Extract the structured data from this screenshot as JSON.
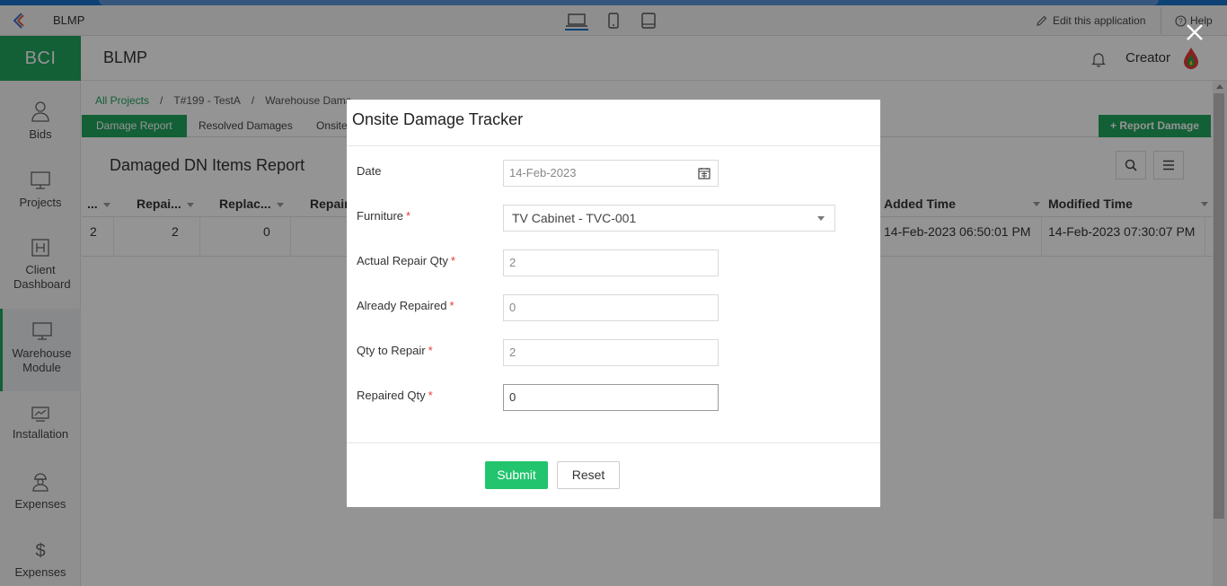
{
  "toolbar": {
    "app_name": "BLMP",
    "edit_app_label": "Edit this application",
    "help_label": "Help"
  },
  "header": {
    "brand": "BCI",
    "title": "BLMP",
    "user": "Creator"
  },
  "sidebar": {
    "items": [
      {
        "label": "Bids",
        "icon": "user-icon"
      },
      {
        "label": "Projects",
        "icon": "monitor-icon"
      },
      {
        "label": "Client Dashboard",
        "icon": "h-box-icon"
      },
      {
        "label": "Warehouse Module",
        "icon": "monitor-icon",
        "active": true
      },
      {
        "label": "Installation",
        "icon": "chart-icon"
      },
      {
        "label": "Expenses",
        "icon": "worker-icon"
      },
      {
        "label": "Expenses",
        "icon": "dollar-icon"
      }
    ]
  },
  "breadcrumb": {
    "root": "All Projects",
    "project": "T#199 - TestA",
    "current": "Warehouse Dama"
  },
  "tabs": {
    "damage_report": "Damage Report",
    "resolved_damages": "Resolved Damages",
    "onsite": "Onsite",
    "report_damage_button": "+ Report Damage"
  },
  "report": {
    "title": "Damaged DN Items Report",
    "columns": [
      "...",
      "Repai...",
      "Replac...",
      "Repair",
      "Added Time",
      "Modified Time"
    ],
    "rows": [
      {
        "c0": "2",
        "c1": "2",
        "c2": "0",
        "added": "14-Feb-2023 06:50:01 PM",
        "modified": "14-Feb-2023 07:30:07 PM"
      }
    ]
  },
  "modal": {
    "title": "Onsite Damage Tracker",
    "fields": {
      "date": {
        "label": "Date",
        "value": "14-Feb-2023"
      },
      "furniture": {
        "label": "Furniture",
        "value": "TV Cabinet - TVC-001"
      },
      "actual_repair_qty": {
        "label": "Actual Repair Qty",
        "value": "2"
      },
      "already_repaired": {
        "label": "Already Repaired",
        "value": "0"
      },
      "qty_to_repair": {
        "label": "Qty to Repair",
        "value": "2"
      },
      "repaired_qty": {
        "label": "Repaired Qty",
        "value": "0"
      }
    },
    "required_mark": "*",
    "submit_label": "Submit",
    "reset_label": "Reset"
  },
  "colors": {
    "brand_green": "#22a45d",
    "submit_green": "#22c46e",
    "top_blue": "#1a73c9",
    "required_red": "#e53935"
  }
}
